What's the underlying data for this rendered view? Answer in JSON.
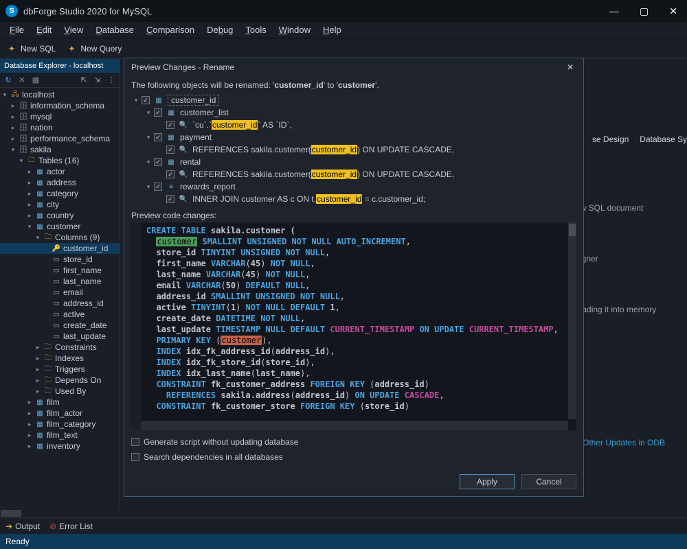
{
  "window": {
    "title": "dbForge Studio 2020 for MySQL",
    "logo_char": "S"
  },
  "menu": [
    "File",
    "Edit",
    "View",
    "Database",
    "Comparison",
    "Debug",
    "Tools",
    "Window",
    "Help"
  ],
  "toolbar": {
    "new_sql": "New SQL",
    "new_query": "New Query"
  },
  "explorer": {
    "title": "Database Explorer - localhost",
    "connection": "localhost",
    "databases": [
      "information_schema",
      "mysql",
      "nation",
      "performance_schema"
    ],
    "open_db": "sakila",
    "tables_folder": "Tables (16)",
    "tables_before": [
      "actor",
      "address",
      "category",
      "city",
      "country"
    ],
    "open_table": "customer",
    "columns_folder": "Columns (9)",
    "columns": [
      "customer_id",
      "store_id",
      "first_name",
      "last_name",
      "email",
      "address_id",
      "active",
      "create_date",
      "last_update"
    ],
    "sel_col": "customer_id",
    "sub_folders": [
      "Constraints",
      "Indexes",
      "Triggers",
      "Depends On",
      "Used By"
    ],
    "tables_after": [
      "film",
      "film_actor",
      "film_category",
      "film_text",
      "inventory"
    ]
  },
  "dialog": {
    "title": "Preview Changes - Rename",
    "message_prefix": "The following objects will be renamed: ",
    "rename_from": "customer_id",
    "rename_to": "customer",
    "root": "customer_id",
    "groups": [
      {
        "name": "customer_list",
        "icon": "view",
        "detail_pre": "`cu`.`",
        "hl": "customer_id",
        "detail_post": "` AS `ID`,"
      },
      {
        "name": "payment",
        "icon": "table",
        "detail_pre": "REFERENCES sakila.customer(",
        "hl": "customer_id",
        "detail_post": ") ON UPDATE CASCADE,"
      },
      {
        "name": "rental",
        "icon": "table",
        "detail_pre": "REFERENCES sakila.customer(",
        "hl": "customer_id",
        "detail_post": ") ON UPDATE CASCADE,"
      },
      {
        "name": "rewards_report",
        "icon": "proc",
        "detail_pre": "INNER JOIN customer AS c ON t.",
        "hl": "customer_id",
        "detail_post": " = c.customer_id;"
      }
    ],
    "preview_label": "Preview code changes:",
    "code": {
      "l1_create": "CREATE TABLE",
      "l1_name": " sakila.customer (",
      "l2_hl": "customer",
      "l2": " SMALLINT UNSIGNED NOT NULL AUTO_INCREMENT",
      "l3_name": "store_id",
      "l3_type": "TINYINT UNSIGNED",
      "l3_nn": "NOT NULL",
      "l4_name": "first_name",
      "l4_type": "VARCHAR",
      "l4_n": "45",
      "l4_nn": "NOT NULL",
      "l5_name": "last_name",
      "l5_type": "VARCHAR",
      "l5_n": "45",
      "l5_nn": "NOT NULL",
      "l6_name": "email",
      "l6_type": "VARCHAR",
      "l6_n": "50",
      "l6_def": "DEFAULT NULL",
      "l7_name": "address_id",
      "l7_type": "SMALLINT UNSIGNED",
      "l7_nn": "NOT NULL",
      "l8_name": "active",
      "l8_type": "TINYINT",
      "l8_n": "1",
      "l8_nn": "NOT NULL",
      "l8_def": "DEFAULT",
      "l8_dv": "1",
      "l9_name": "create_date",
      "l9_type": "DATETIME",
      "l9_nn": "NOT NULL",
      "l10_name": "last_update",
      "l10_type": "TIMESTAMP",
      "l10_null": "NULL",
      "l10_def": "DEFAULT",
      "l10_ct": "CURRENT_TIMESTAMP",
      "l10_on": "ON UPDATE",
      "l10_ct2": "CURRENT_TIMESTAMP",
      "l11_pk": "PRIMARY KEY",
      "l11_hl": "customer",
      "l12_idx": "INDEX",
      "l12_name": "idx_fk_address_id",
      "l12_col": "address_id",
      "l13_idx": "INDEX",
      "l13_name": "idx_fk_store_id",
      "l13_col": "store_id",
      "l14_idx": "INDEX",
      "l14_name": "idx_last_name",
      "l14_col": "last_name",
      "l15_con": "CONSTRAINT",
      "l15_name": "fk_customer_address",
      "l15_fk": "FOREIGN KEY",
      "l15_col": "address_id",
      "l16_ref": "REFERENCES",
      "l16_tbl": "sakila.address",
      "l16_col": "address_id",
      "l16_on": "ON UPDATE",
      "l16_casc": "CASCADE",
      "l17_con": "CONSTRAINT",
      "l17_name": "fk_customer_store",
      "l17_fk": "FOREIGN KEY",
      "l17_col": "store_id"
    },
    "opt1": "Generate script without updating database",
    "opt2": "Search dependencies in all databases",
    "btn_apply": "Apply",
    "btn_cancel": "Cancel"
  },
  "right": {
    "t1": "se Design",
    "t2": "Database Sy",
    "hint1": "ew SQL document",
    "hint2": "signer",
    "hint3": "loading it into memory",
    "link": "d Other Updates in ODB"
  },
  "bottom": {
    "output": "Output",
    "error_list": "Error List"
  },
  "status": "Ready"
}
